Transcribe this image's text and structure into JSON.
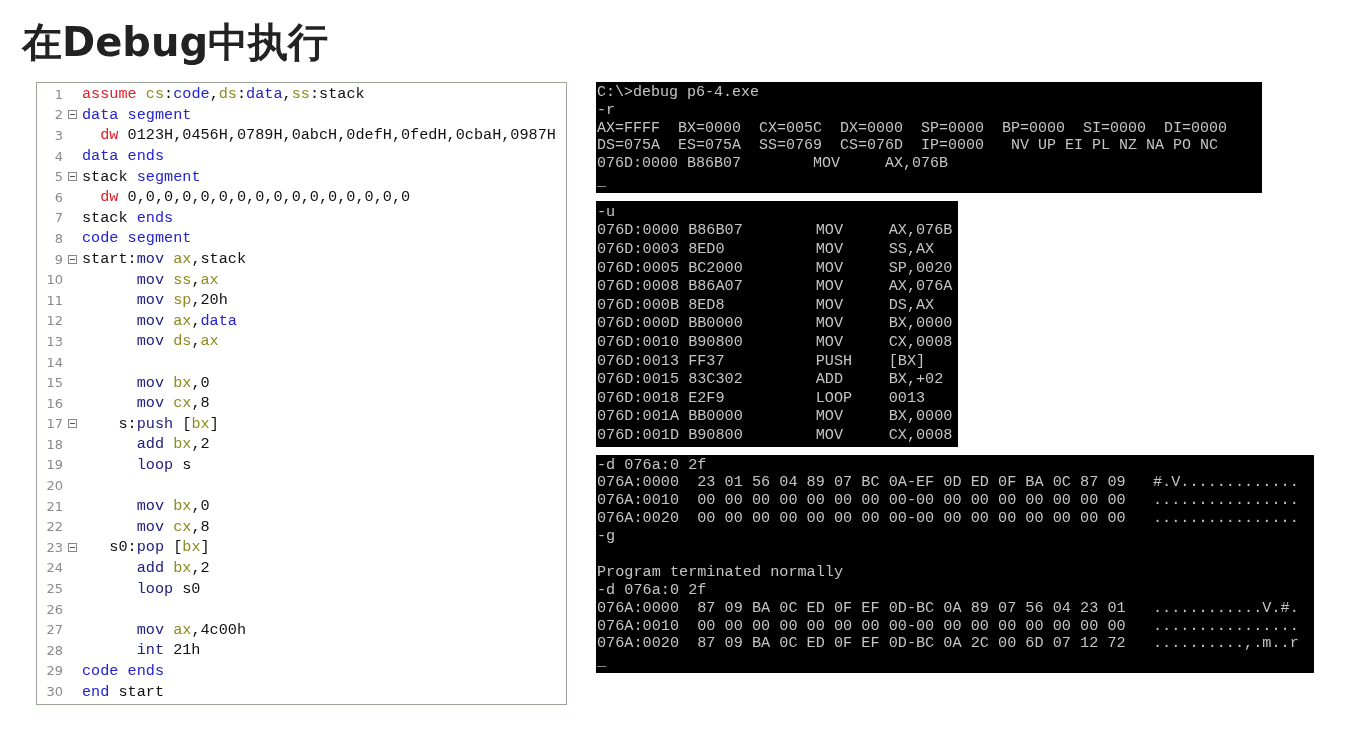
{
  "title": "在Debug中执行",
  "editor": {
    "lines": [
      {
        "number": "1",
        "foldable": false,
        "tokens": [
          {
            "text": "assume",
            "kind": "directive"
          },
          {
            "text": " cs",
            "kind": "register"
          },
          {
            "text": ":",
            "kind": "plain"
          },
          {
            "text": "code",
            "kind": "keyword"
          },
          {
            "text": ",",
            "kind": "plain"
          },
          {
            "text": "ds",
            "kind": "register"
          },
          {
            "text": ":",
            "kind": "plain"
          },
          {
            "text": "data",
            "kind": "keyword"
          },
          {
            "text": ",",
            "kind": "plain"
          },
          {
            "text": "ss",
            "kind": "register"
          },
          {
            "text": ":stack",
            "kind": "plain"
          }
        ]
      },
      {
        "number": "2",
        "foldable": true,
        "tokens": [
          {
            "text": "data segment",
            "kind": "keyword"
          }
        ]
      },
      {
        "number": "3",
        "foldable": false,
        "tokens": [
          {
            "text": "  dw",
            "kind": "directive"
          },
          {
            "text": " 0123H,0456H,0789H,0abcH,0defH,0fedH,0cbaH,0987H",
            "kind": "plain"
          }
        ]
      },
      {
        "number": "4",
        "foldable": false,
        "tokens": [
          {
            "text": "data ends",
            "kind": "keyword"
          }
        ]
      },
      {
        "number": "5",
        "foldable": true,
        "tokens": [
          {
            "text": "stack",
            "kind": "plain"
          },
          {
            "text": " segment",
            "kind": "keyword"
          }
        ]
      },
      {
        "number": "6",
        "foldable": false,
        "tokens": [
          {
            "text": "  dw",
            "kind": "directive"
          },
          {
            "text": " 0,0,0,0,0,0,0,0,0,0,0,0,0,0,0,0",
            "kind": "plain"
          }
        ]
      },
      {
        "number": "7",
        "foldable": false,
        "tokens": [
          {
            "text": "stack",
            "kind": "plain"
          },
          {
            "text": " ends",
            "kind": "keyword"
          }
        ]
      },
      {
        "number": "8",
        "foldable": false,
        "tokens": [
          {
            "text": "code segment",
            "kind": "keyword"
          }
        ]
      },
      {
        "number": "9",
        "foldable": true,
        "tokens": [
          {
            "text": "start:",
            "kind": "plain"
          },
          {
            "text": "mov",
            "kind": "instruction"
          },
          {
            "text": " ax",
            "kind": "register"
          },
          {
            "text": ",stack",
            "kind": "plain"
          }
        ]
      },
      {
        "number": "10",
        "foldable": false,
        "tokens": [
          {
            "text": "      mov",
            "kind": "instruction"
          },
          {
            "text": " ss",
            "kind": "register"
          },
          {
            "text": ",",
            "kind": "plain"
          },
          {
            "text": "ax",
            "kind": "register"
          }
        ]
      },
      {
        "number": "11",
        "foldable": false,
        "tokens": [
          {
            "text": "      mov",
            "kind": "instruction"
          },
          {
            "text": " sp",
            "kind": "register"
          },
          {
            "text": ",20h",
            "kind": "plain"
          }
        ]
      },
      {
        "number": "12",
        "foldable": false,
        "tokens": [
          {
            "text": "      mov",
            "kind": "instruction"
          },
          {
            "text": " ax",
            "kind": "register"
          },
          {
            "text": ",",
            "kind": "plain"
          },
          {
            "text": "data",
            "kind": "keyword"
          }
        ]
      },
      {
        "number": "13",
        "foldable": false,
        "tokens": [
          {
            "text": "      mov",
            "kind": "instruction"
          },
          {
            "text": " ds",
            "kind": "register"
          },
          {
            "text": ",",
            "kind": "plain"
          },
          {
            "text": "ax",
            "kind": "register"
          }
        ]
      },
      {
        "number": "14",
        "foldable": false
      },
      {
        "number": "15",
        "foldable": false,
        "tokens": [
          {
            "text": "      mov",
            "kind": "instruction"
          },
          {
            "text": " bx",
            "kind": "register"
          },
          {
            "text": ",0",
            "kind": "plain"
          }
        ]
      },
      {
        "number": "16",
        "foldable": false,
        "tokens": [
          {
            "text": "      mov",
            "kind": "instruction"
          },
          {
            "text": " cx",
            "kind": "register"
          },
          {
            "text": ",8",
            "kind": "plain"
          }
        ]
      },
      {
        "number": "17",
        "foldable": true,
        "tokens": [
          {
            "text": "    s:",
            "kind": "plain"
          },
          {
            "text": "push",
            "kind": "instruction"
          },
          {
            "text": " [",
            "kind": "plain"
          },
          {
            "text": "bx",
            "kind": "register"
          },
          {
            "text": "]",
            "kind": "plain"
          }
        ]
      },
      {
        "number": "18",
        "foldable": false,
        "tokens": [
          {
            "text": "      add",
            "kind": "instruction"
          },
          {
            "text": " bx",
            "kind": "register"
          },
          {
            "text": ",2",
            "kind": "plain"
          }
        ]
      },
      {
        "number": "19",
        "foldable": false,
        "tokens": [
          {
            "text": "      loop",
            "kind": "instruction"
          },
          {
            "text": " s",
            "kind": "plain"
          }
        ]
      },
      {
        "number": "20",
        "foldable": false
      },
      {
        "number": "21",
        "foldable": false,
        "tokens": [
          {
            "text": "      mov",
            "kind": "instruction"
          },
          {
            "text": " bx",
            "kind": "register"
          },
          {
            "text": ",0",
            "kind": "plain"
          }
        ]
      },
      {
        "number": "22",
        "foldable": false,
        "tokens": [
          {
            "text": "      mov",
            "kind": "instruction"
          },
          {
            "text": " cx",
            "kind": "register"
          },
          {
            "text": ",8",
            "kind": "plain"
          }
        ]
      },
      {
        "number": "23",
        "foldable": true,
        "tokens": [
          {
            "text": "   s0:",
            "kind": "plain"
          },
          {
            "text": "pop",
            "kind": "instruction"
          },
          {
            "text": " [",
            "kind": "plain"
          },
          {
            "text": "bx",
            "kind": "register"
          },
          {
            "text": "]",
            "kind": "plain"
          }
        ]
      },
      {
        "number": "24",
        "foldable": false,
        "tokens": [
          {
            "text": "      add",
            "kind": "instruction"
          },
          {
            "text": " bx",
            "kind": "register"
          },
          {
            "text": ",2",
            "kind": "plain"
          }
        ]
      },
      {
        "number": "25",
        "foldable": false,
        "tokens": [
          {
            "text": "      loop",
            "kind": "instruction"
          },
          {
            "text": " s0",
            "kind": "plain"
          }
        ]
      },
      {
        "number": "26",
        "foldable": false
      },
      {
        "number": "27",
        "foldable": false,
        "tokens": [
          {
            "text": "      mov",
            "kind": "instruction"
          },
          {
            "text": " ax",
            "kind": "register"
          },
          {
            "text": ",4c00h",
            "kind": "plain"
          }
        ]
      },
      {
        "number": "28",
        "foldable": false,
        "tokens": [
          {
            "text": "      int",
            "kind": "instruction"
          },
          {
            "text": " 21h",
            "kind": "plain"
          }
        ]
      },
      {
        "number": "29",
        "foldable": false,
        "tokens": [
          {
            "text": "code ends",
            "kind": "keyword"
          }
        ]
      },
      {
        "number": "30",
        "foldable": false,
        "tokens": [
          {
            "text": "end",
            "kind": "keyword"
          },
          {
            "text": " start",
            "kind": "plain"
          }
        ]
      }
    ]
  },
  "consoles": [
    {
      "lines": [
        "C:\\>debug p6-4.exe",
        "-r",
        "AX=FFFF  BX=0000  CX=005C  DX=0000  SP=0000  BP=0000  SI=0000  DI=0000",
        "DS=075A  ES=075A  SS=0769  CS=076D  IP=0000   NV UP EI PL NZ NA PO NC",
        "076D:0000 B86B07        MOV     AX,076B",
        "_"
      ]
    },
    {
      "lines": [
        "-u",
        "076D:0000 B86B07        MOV     AX,076B",
        "076D:0003 8ED0          MOV     SS,AX",
        "076D:0005 BC2000        MOV     SP,0020",
        "076D:0008 B86A07        MOV     AX,076A",
        "076D:000B 8ED8          MOV     DS,AX",
        "076D:000D BB0000        MOV     BX,0000",
        "076D:0010 B90800        MOV     CX,0008",
        "076D:0013 FF37          PUSH    [BX]",
        "076D:0015 83C302        ADD     BX,+02",
        "076D:0018 E2F9          LOOP    0013",
        "076D:001A BB0000        MOV     BX,0000",
        "076D:001D B90800        MOV     CX,0008"
      ]
    },
    {
      "lines": [
        "-d 076a:0 2f",
        "076A:0000  23 01 56 04 89 07 BC 0A-EF 0D ED 0F BA 0C 87 09   #.V.............",
        "076A:0010  00 00 00 00 00 00 00 00-00 00 00 00 00 00 00 00   ................",
        "076A:0020  00 00 00 00 00 00 00 00-00 00 00 00 00 00 00 00   ................",
        "-g",
        {
          "kind": "blank"
        },
        "Program terminated normally",
        "-d 076a:0 2f",
        "076A:0000  87 09 BA 0C ED 0F EF 0D-BC 0A 89 07 56 04 23 01   ............V.#.",
        "076A:0010  00 00 00 00 00 00 00 00-00 00 00 00 00 00 00 00   ................",
        "076A:0020  87 09 BA 0C ED 0F EF 0D-BC 0A 2C 00 6D 07 12 72   ..........,.m..r",
        "_"
      ]
    }
  ]
}
